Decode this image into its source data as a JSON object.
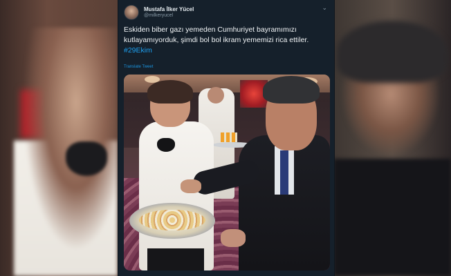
{
  "tweet": {
    "author_name": "Mustafa İlker Yücel",
    "author_handle": "@milkeryucel",
    "text_main": "Eskiden biber gazı yemeden Cumhuriyet bayramımızı kutlayamıyorduk, şimdi bol bol ikram yememizi rica ettiler. ",
    "hashtag": "#29Ekim",
    "translate_label": "Translate Tweet",
    "menu_icon": "chevron-down-icon"
  },
  "colors": {
    "card_bg": "#15202b",
    "link": "#1da1f2",
    "secondary_text": "#8899a6"
  }
}
